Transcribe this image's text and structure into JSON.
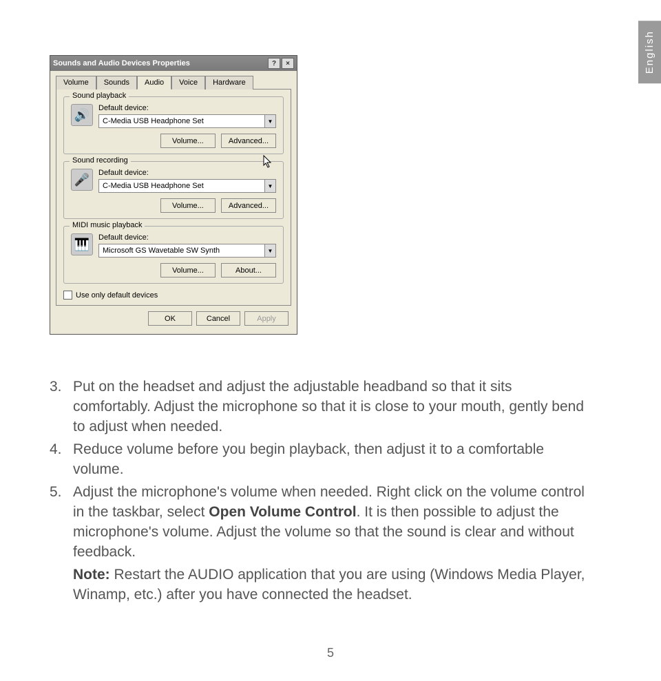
{
  "language_tab": "English",
  "dialog": {
    "title": "Sounds and Audio Devices Properties",
    "help_btn": "?",
    "close_btn": "×",
    "tabs": [
      "Volume",
      "Sounds",
      "Audio",
      "Voice",
      "Hardware"
    ],
    "active_tab": "Audio",
    "groups": {
      "playback": {
        "title": "Sound playback",
        "label": "Default device:",
        "value": "C-Media USB Headphone Set",
        "btn1": "Volume...",
        "btn2": "Advanced..."
      },
      "recording": {
        "title": "Sound recording",
        "label": "Default device:",
        "value": "C-Media USB Headphone Set",
        "btn1": "Volume...",
        "btn2": "Advanced..."
      },
      "midi": {
        "title": "MIDI music playback",
        "label": "Default device:",
        "value": "Microsoft GS Wavetable SW Synth",
        "btn1": "Volume...",
        "btn2": "About..."
      }
    },
    "checkbox": "Use only default devices",
    "ok": "OK",
    "cancel": "Cancel",
    "apply": "Apply"
  },
  "instructions": {
    "i3_num": "3.",
    "i3a": "Put on the headset and adjust the adjustable headband so that it sits comfortably. Adjust the microphone so that it is close to your mouth, gently bend to adjust when needed.",
    "i4_num": "4.",
    "i4": "Reduce volume before you begin playback, then adjust it to a comfortable volume.",
    "i5_num": "5.",
    "i5a": "Adjust the microphone's volume when needed. Right click on the volume control in the taskbar, select ",
    "i5_bold": "Open Volume Control",
    "i5b": ". It is then possible to adjust the microphone's volume. Adjust the volume so that the sound is clear and without feedback.",
    "note_bold": "Note:",
    "note": " Restart the AUDIO application that you are using (Windows Media Player, Winamp, etc.) after you have connected the headset."
  },
  "page_number": "5"
}
